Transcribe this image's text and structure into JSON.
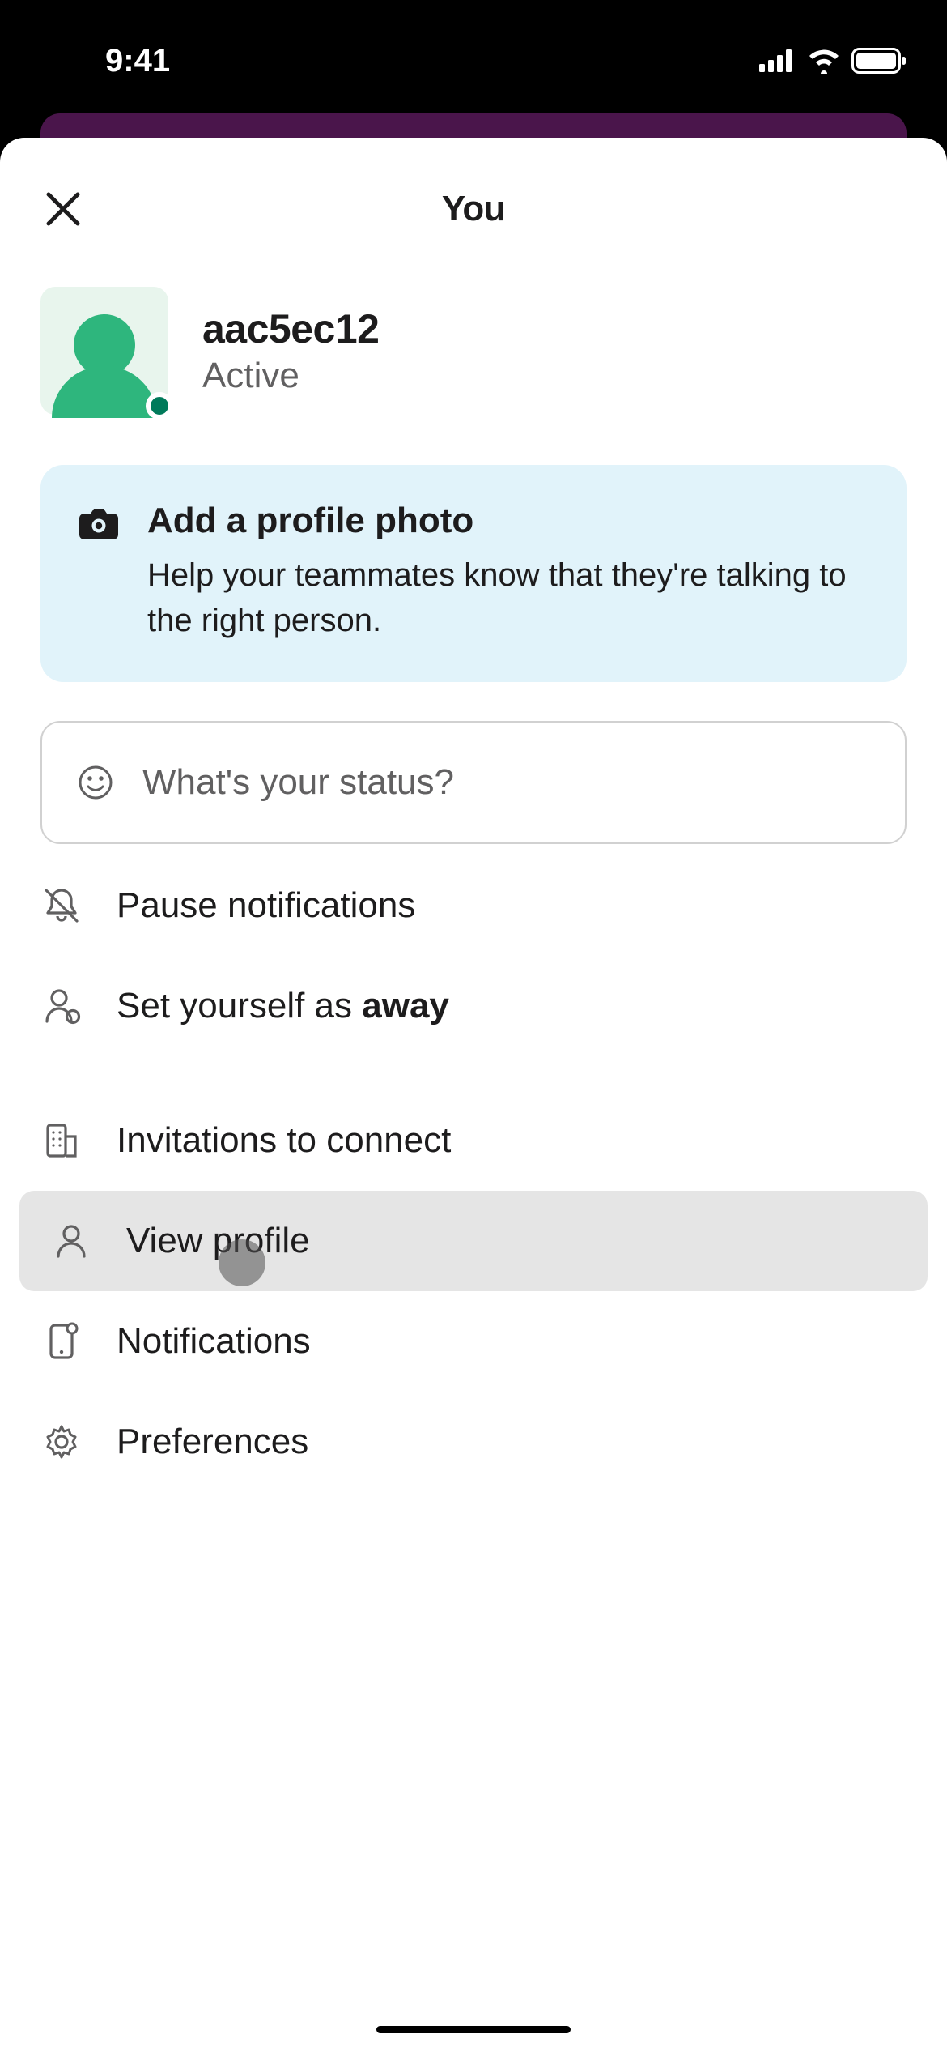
{
  "statusBar": {
    "time": "9:41"
  },
  "header": {
    "title": "You"
  },
  "profile": {
    "username": "aac5ec12",
    "status": "Active"
  },
  "card": {
    "title": "Add a profile photo",
    "subtitle": "Help your teammates know that they're talking to the right person."
  },
  "statusInput": {
    "placeholder": "What's your status?"
  },
  "menu": {
    "pause": "Pause notifications",
    "away_prefix": "Set yourself as ",
    "away_bold": "away",
    "invitations": "Invitations to connect",
    "viewProfile": "View profile",
    "notifications": "Notifications",
    "preferences": "Preferences"
  }
}
